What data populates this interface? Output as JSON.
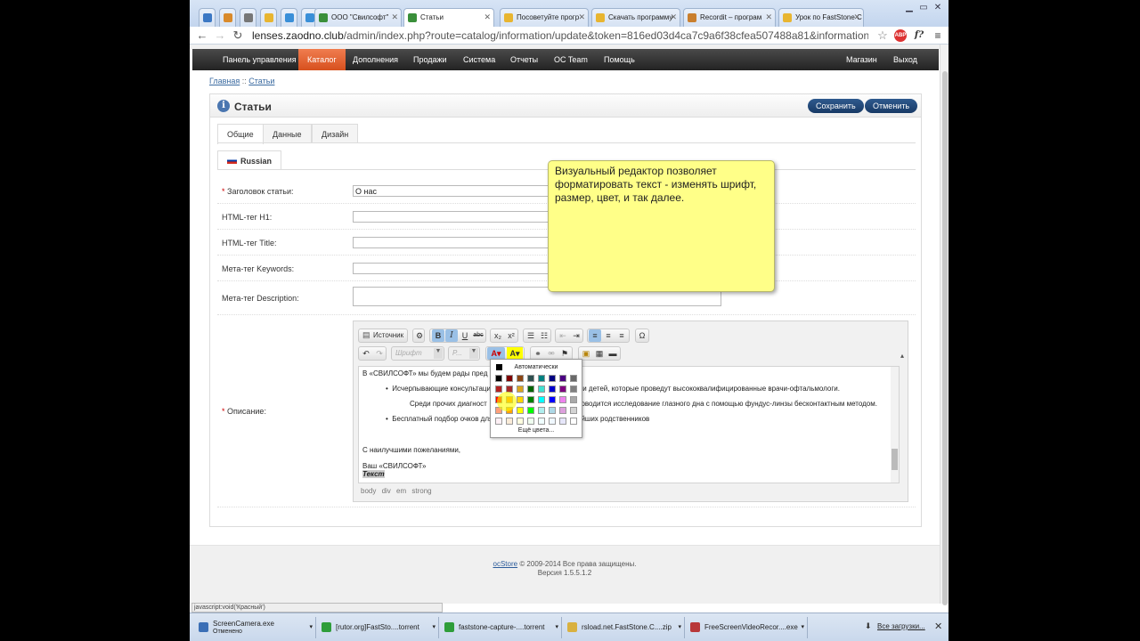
{
  "browser": {
    "tabs": [
      {
        "title": "ООО \"Свилсофт\"",
        "fav_color": "#3a8f3a",
        "active": false
      },
      {
        "title": "Статьи",
        "fav_color": "#3a8f3a",
        "active": true
      },
      {
        "title": "Посоветуйте прогр",
        "fav_color": "#e8b530",
        "active": false
      },
      {
        "title": "Скачать программу",
        "fav_color": "#e8b530",
        "active": false
      },
      {
        "title": "Recordit – програм",
        "fav_color": "#c97f2e",
        "active": false
      },
      {
        "title": "Урок по FastStone C",
        "fav_color": "#e8b530",
        "active": false
      }
    ],
    "url_domain": "lenses.zaodno.club",
    "url_path": "/admin/index.php?route=catalog/information/update&token=816ed03d4ca7c9a6f38cfea507488a81&information_id=13"
  },
  "topnav": {
    "items": [
      "Панель управления",
      "Каталог",
      "Дополнения",
      "Продажи",
      "Система",
      "Отчеты",
      "OC Team",
      "Помощь"
    ],
    "right": [
      "Магазин",
      "Выход"
    ]
  },
  "breadcrumb": {
    "home": "Главная",
    "sep": " :: ",
    "current": "Статьи"
  },
  "panel": {
    "title": "Статьи",
    "save": "Сохранить",
    "cancel": "Отменить",
    "tabs": [
      "Общие",
      "Данные",
      "Дизайн"
    ],
    "language": "Russian"
  },
  "form": {
    "title_label": "Заголовок статьи:",
    "title_value": "О нас",
    "h1_label": "HTML-тег H1:",
    "title_tag_label": "HTML-тег Title:",
    "keywords_label": "Мета-тег Keywords:",
    "description_label": "Мета-тег Description:",
    "body_label": "Описание:",
    "required_mark": "*"
  },
  "editor": {
    "source_label": "Источник",
    "font_placeholder": "Шрифт",
    "size_placeholder": "Р...",
    "lines": [
      "В «СВИЛСОФТ» мы будем рады пред",
      "Исчерпывающие консультаци",
      "х и детей, которые проведут высококвалифицированные врачи-офтальмологи.",
      "Среди прочих диагност",
      "роводится исследование глазного дна с помощью фундус-линзы бесконтактным методом.",
      "Бесплатный подбор очков для",
      "айших родственников",
      "С наилучшими пожеланиями,",
      "Ваш «СВИЛСОФТ»",
      "Текст"
    ],
    "path": "body div em strong"
  },
  "color_picker": {
    "auto_label": "Автоматически",
    "more_label": "Ещё цвета...",
    "swatches": [
      "#000000",
      "#800000",
      "#8b4513",
      "#2f4f4f",
      "#008080",
      "#000080",
      "#4b0082",
      "#696969",
      "#b22222",
      "#a52a2a",
      "#daa520",
      "#006400",
      "#40e0d0",
      "#0000cd",
      "#800080",
      "#808080",
      "#ff0000",
      "#ff8c00",
      "#ffd700",
      "#008000",
      "#00ffff",
      "#0000ff",
      "#ee82ee",
      "#a9a9a9",
      "#ffa07a",
      "#ffa500",
      "#ffff00",
      "#00ff00",
      "#afeeee",
      "#add8e6",
      "#dda0dd",
      "#d3d3d3",
      "#fff0f5",
      "#faebd7",
      "#ffffe0",
      "#f0fff0",
      "#f0ffff",
      "#f0f8ff",
      "#e6e6fa",
      "#ffffff"
    ]
  },
  "tooltip": "Визуальный редактор позволяет форматировать текст - изменять шрифт, размер, цвет, и так далее.",
  "footer": {
    "link": "ocStore",
    "copyright": " © 2009-2014 Все права защищены.",
    "version": "Версия 1.5.5.1.2"
  },
  "statusbar": "javascript:void('Красный')",
  "downloads": [
    {
      "name": "ScreenCamera.exe",
      "sub": "Отменено",
      "color": "#3b6fb6"
    },
    {
      "name": "[rutor.org]FastSto....torrent",
      "sub": "",
      "color": "#2e9d3a"
    },
    {
      "name": "faststone-capture-....torrent",
      "sub": "",
      "color": "#2e9d3a"
    },
    {
      "name": "rsload.net.FastStone.C....zip",
      "sub": "",
      "color": "#d9b140"
    },
    {
      "name": "FreeScreenVideoRecor....exe",
      "sub": "",
      "color": "#b8383a"
    }
  ],
  "downloads_all": "Все загрузки..."
}
